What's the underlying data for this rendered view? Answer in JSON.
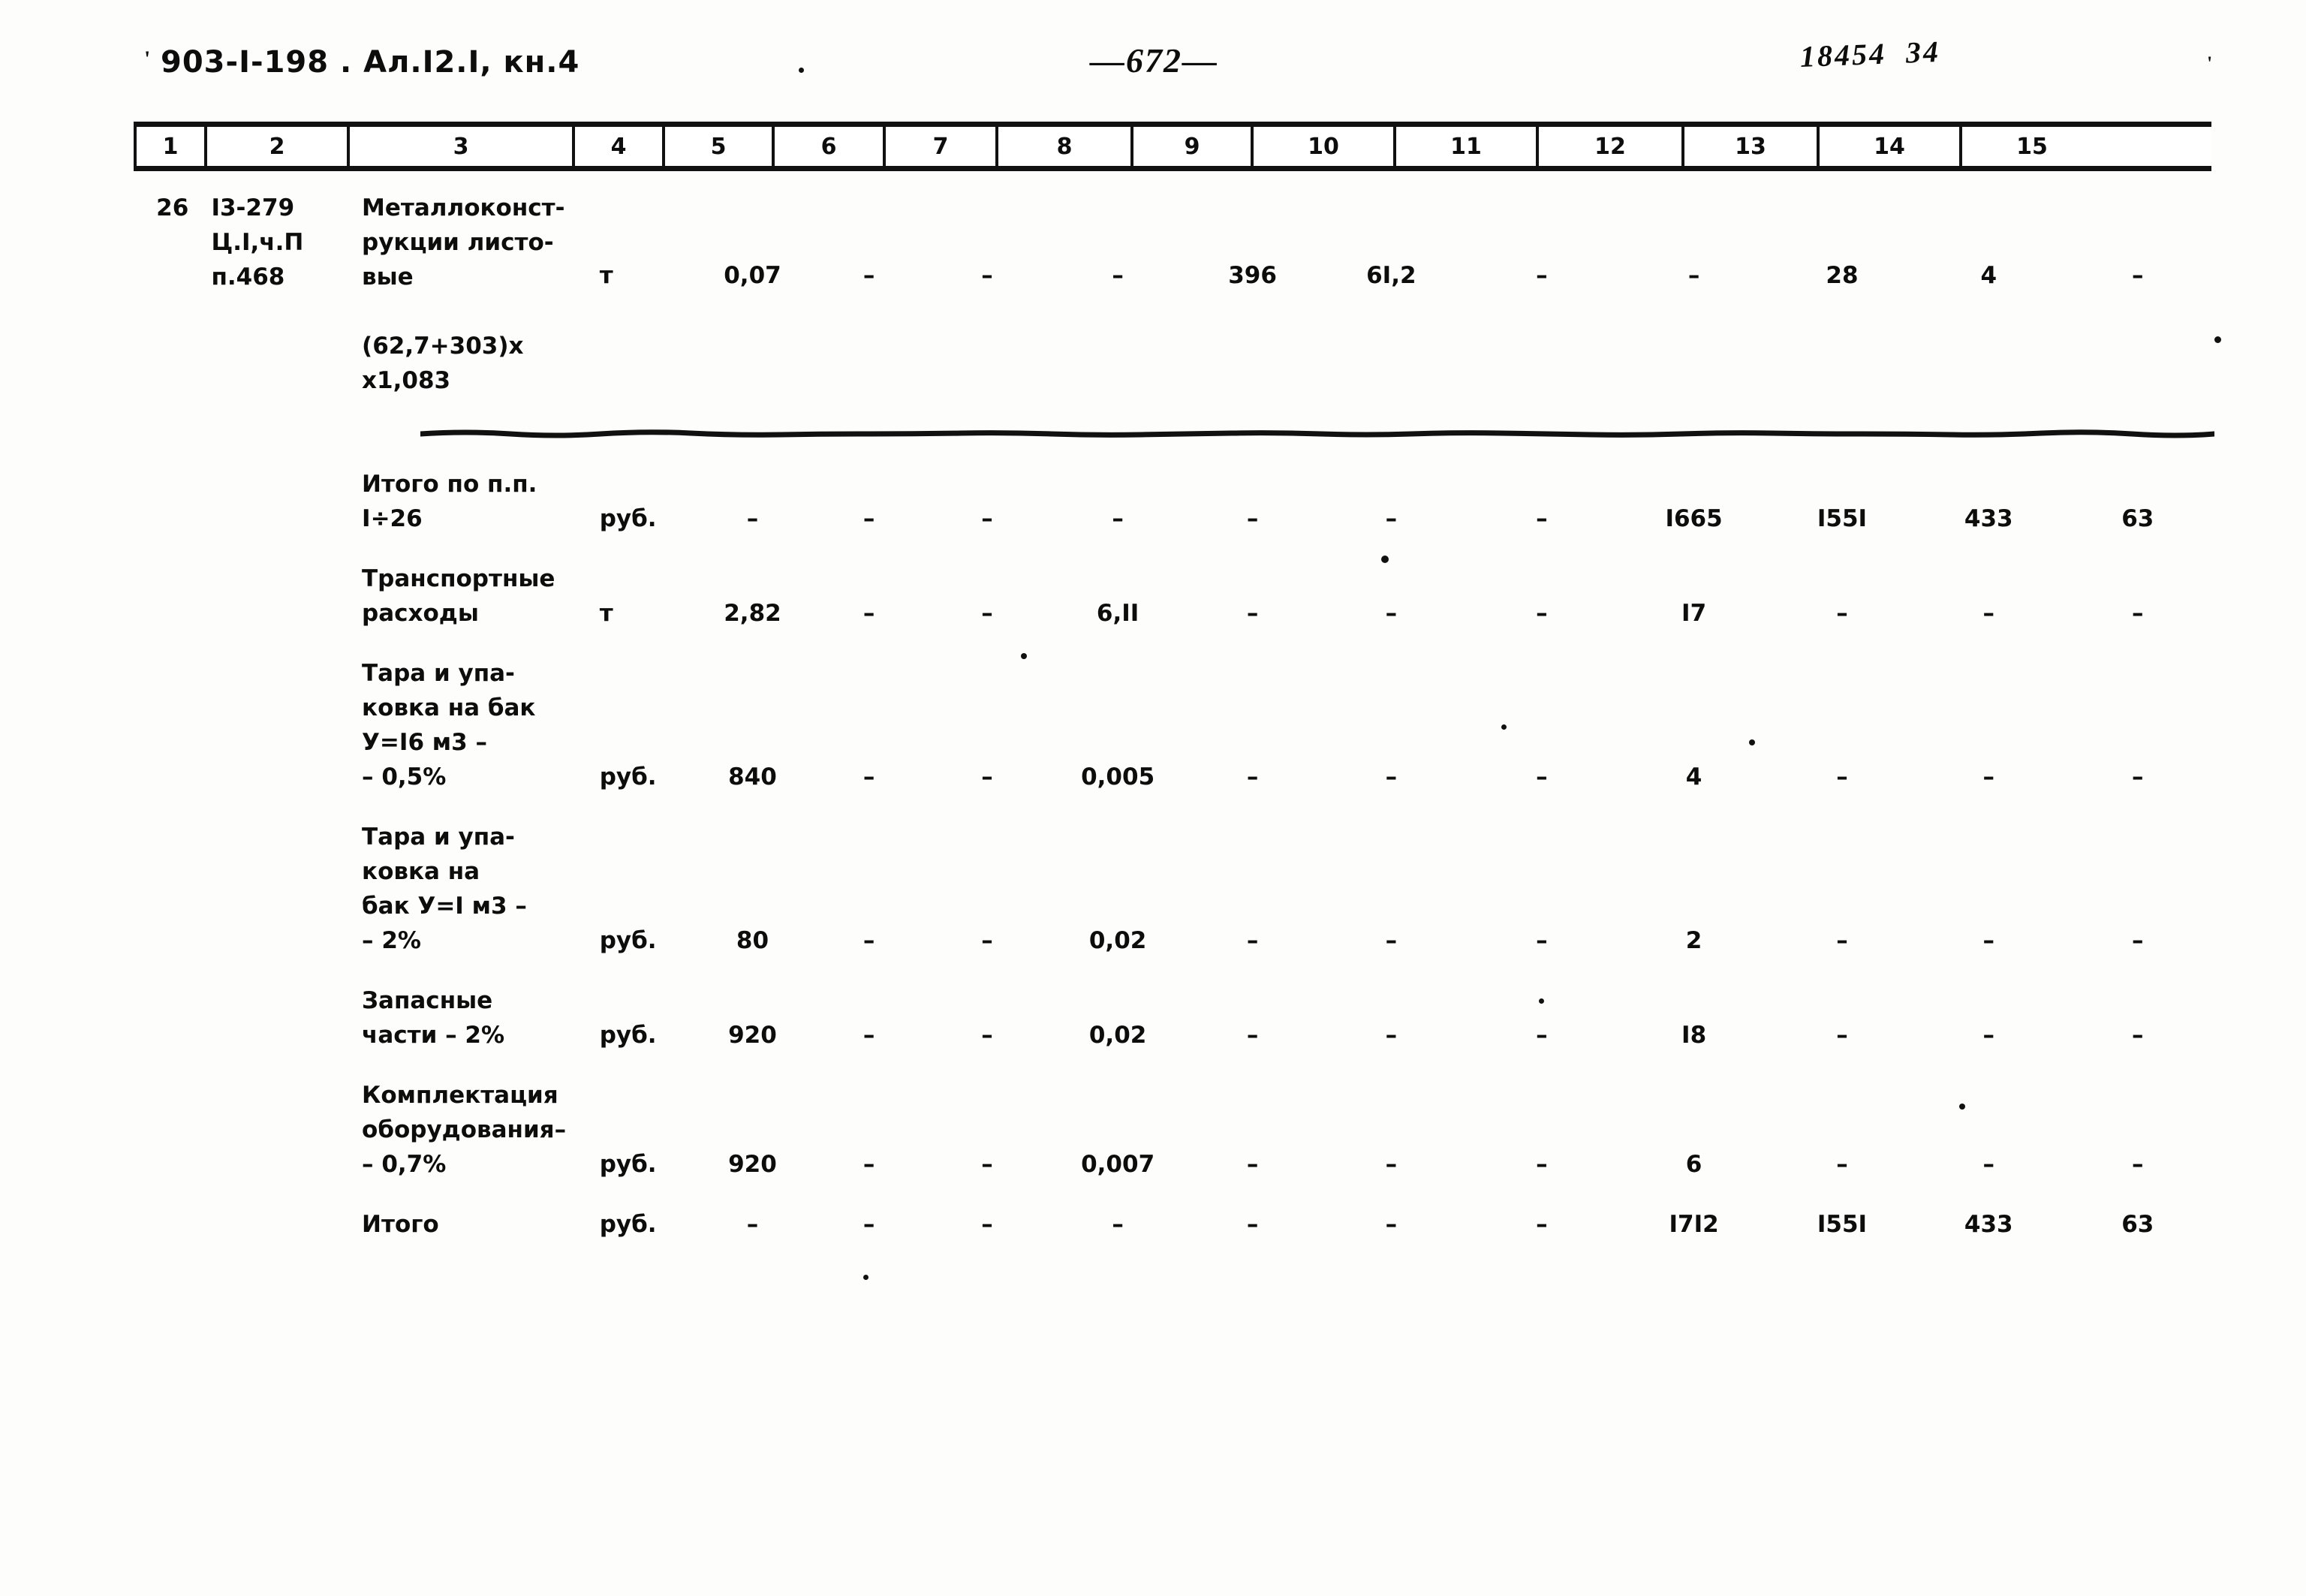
{
  "header": {
    "doc_code": "903-I-198 . Ал.I2.I, кн.4",
    "page_number": "—672—",
    "stamp_number": "18454  34",
    "tick": "'",
    "corner_tick": "'"
  },
  "table": {
    "column_numbers": [
      "1",
      "2",
      "3",
      "4",
      "5",
      "6",
      "7",
      "8",
      "9",
      "10",
      "11",
      "12",
      "13",
      "14",
      "15"
    ],
    "rows": [
      {
        "name": "row-26",
        "n": "26",
        "code": "I3-279\nЦ.I,ч.П\nп.468",
        "desc": "Металлоконст-\nрукции листо-\nвые\n\n(62,7+303)х\nх1,083",
        "unit": "т",
        "c5": "0,07",
        "c6": "–",
        "c7": "–",
        "c8": "–",
        "c9": "396",
        "c10": "6I,2",
        "c11": "–",
        "c12": "–",
        "c13": "28",
        "c14": "4",
        "c15": "–"
      },
      {
        "name": "row-itogo-pp",
        "n": "",
        "code": "",
        "desc": "Итого по п.п.\nI÷26",
        "unit": "руб.",
        "c5": "–",
        "c6": "–",
        "c7": "–",
        "c8": "–",
        "c9": "–",
        "c10": "–",
        "c11": "–",
        "c12": "I665",
        "c13": "I55I",
        "c14": "433",
        "c15": "63"
      },
      {
        "name": "row-transport",
        "n": "",
        "code": "",
        "desc": "Транспортные\nрасходы",
        "unit": "т",
        "c5": "2,82",
        "c6": "–",
        "c7": "–",
        "c8": "6,II",
        "c9": "–",
        "c10": "–",
        "c11": "–",
        "c12": "I7",
        "c13": "–",
        "c14": "–",
        "c15": "–"
      },
      {
        "name": "row-tara-16",
        "n": "",
        "code": "",
        "desc": "Тара и упа-\nковка на бак\nУ=I6 м3 –\n– 0,5%",
        "unit": "руб.",
        "c5": "840",
        "c6": "–",
        "c7": "–",
        "c8": "0,005",
        "c9": "–",
        "c10": "–",
        "c11": "–",
        "c12": "4",
        "c13": "–",
        "c14": "–",
        "c15": "–"
      },
      {
        "name": "row-tara-1",
        "n": "",
        "code": "",
        "desc": "Тара и упа-\nковка на\nбак У=I м3 –\n– 2%",
        "unit": "руб.",
        "c5": "80",
        "c6": "–",
        "c7": "–",
        "c8": "0,02",
        "c9": "–",
        "c10": "–",
        "c11": "–",
        "c12": "2",
        "c13": "–",
        "c14": "–",
        "c15": "–"
      },
      {
        "name": "row-zapchasti",
        "n": "",
        "code": "",
        "desc": "Запасные\nчасти – 2%",
        "unit": "руб.",
        "c5": "920",
        "c6": "–",
        "c7": "–",
        "c8": "0,02",
        "c9": "–",
        "c10": "–",
        "c11": "–",
        "c12": "I8",
        "c13": "–",
        "c14": "–",
        "c15": "–"
      },
      {
        "name": "row-komplektacia",
        "n": "",
        "code": "",
        "desc": "Комплектация\nоборудования–\n– 0,7%",
        "unit": "руб.",
        "c5": "920",
        "c6": "–",
        "c7": "–",
        "c8": "0,007",
        "c9": "–",
        "c10": "–",
        "c11": "–",
        "c12": "6",
        "c13": "–",
        "c14": "–",
        "c15": "–"
      },
      {
        "name": "row-itogo",
        "n": "",
        "code": "",
        "desc": "Итого",
        "unit": "руб.",
        "c5": "–",
        "c6": "–",
        "c7": "–",
        "c8": "–",
        "c9": "–",
        "c10": "–",
        "c11": "–",
        "c12": "I7I2",
        "c13": "I55I",
        "c14": "433",
        "c15": "63"
      }
    ]
  }
}
